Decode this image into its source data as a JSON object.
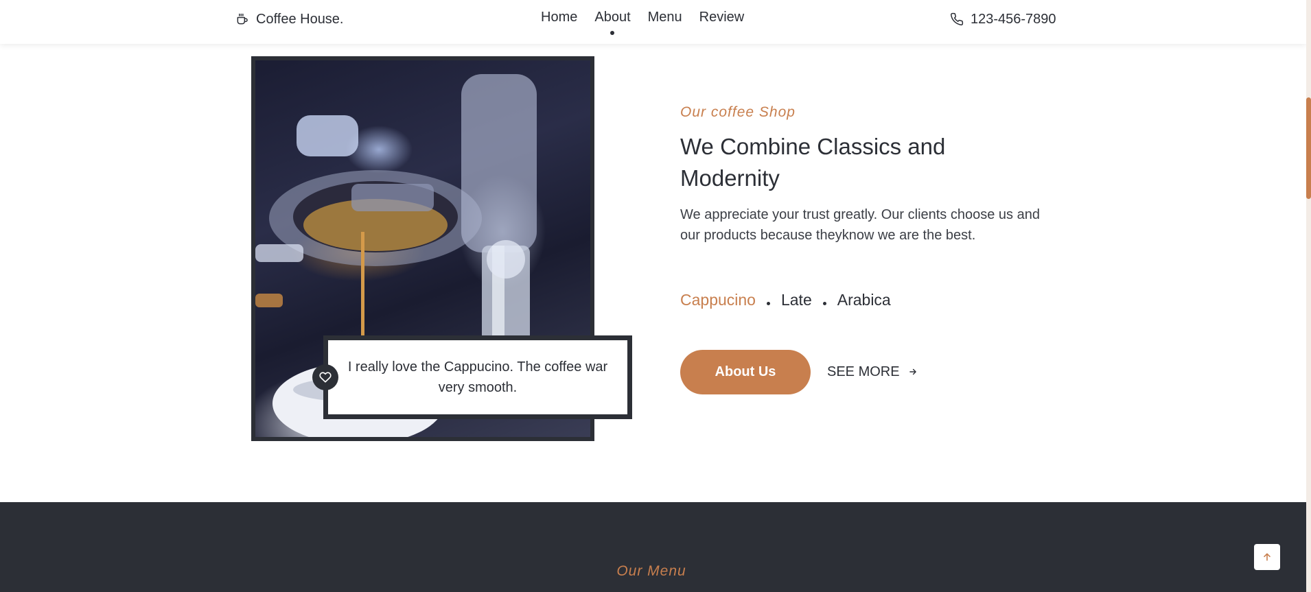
{
  "header": {
    "brand": "Coffee House.",
    "brand_icon": "coffee-cup-icon",
    "nav": [
      {
        "label": "Home",
        "active": false
      },
      {
        "label": "About",
        "active": true
      },
      {
        "label": "Menu",
        "active": false
      },
      {
        "label": "Review",
        "active": false
      }
    ],
    "phone_icon": "phone-icon",
    "phone": "123-456-7890"
  },
  "about": {
    "kicker": "Our coffee Shop",
    "heading": "We Combine Classics and Modernity",
    "description": "We appreciate your trust greatly. Our clients choose us and our products because theyknow we are the best.",
    "tags": [
      "Cappucino",
      "Late",
      "Arabica"
    ],
    "highlighted_tag": "Cappucino",
    "button_label": "About Us",
    "see_more_label": "SEE MORE",
    "quote": "I really love the Cappucino. The coffee war very smooth.",
    "quote_icon": "heart-icon",
    "image_alt": "espresso machine pouring coffee"
  },
  "menu": {
    "kicker": "Our Menu"
  },
  "scroll_top_icon": "arrow-up-icon",
  "colors": {
    "accent": "#c87f4e",
    "dark": "#2c2f36",
    "white": "#ffffff"
  }
}
